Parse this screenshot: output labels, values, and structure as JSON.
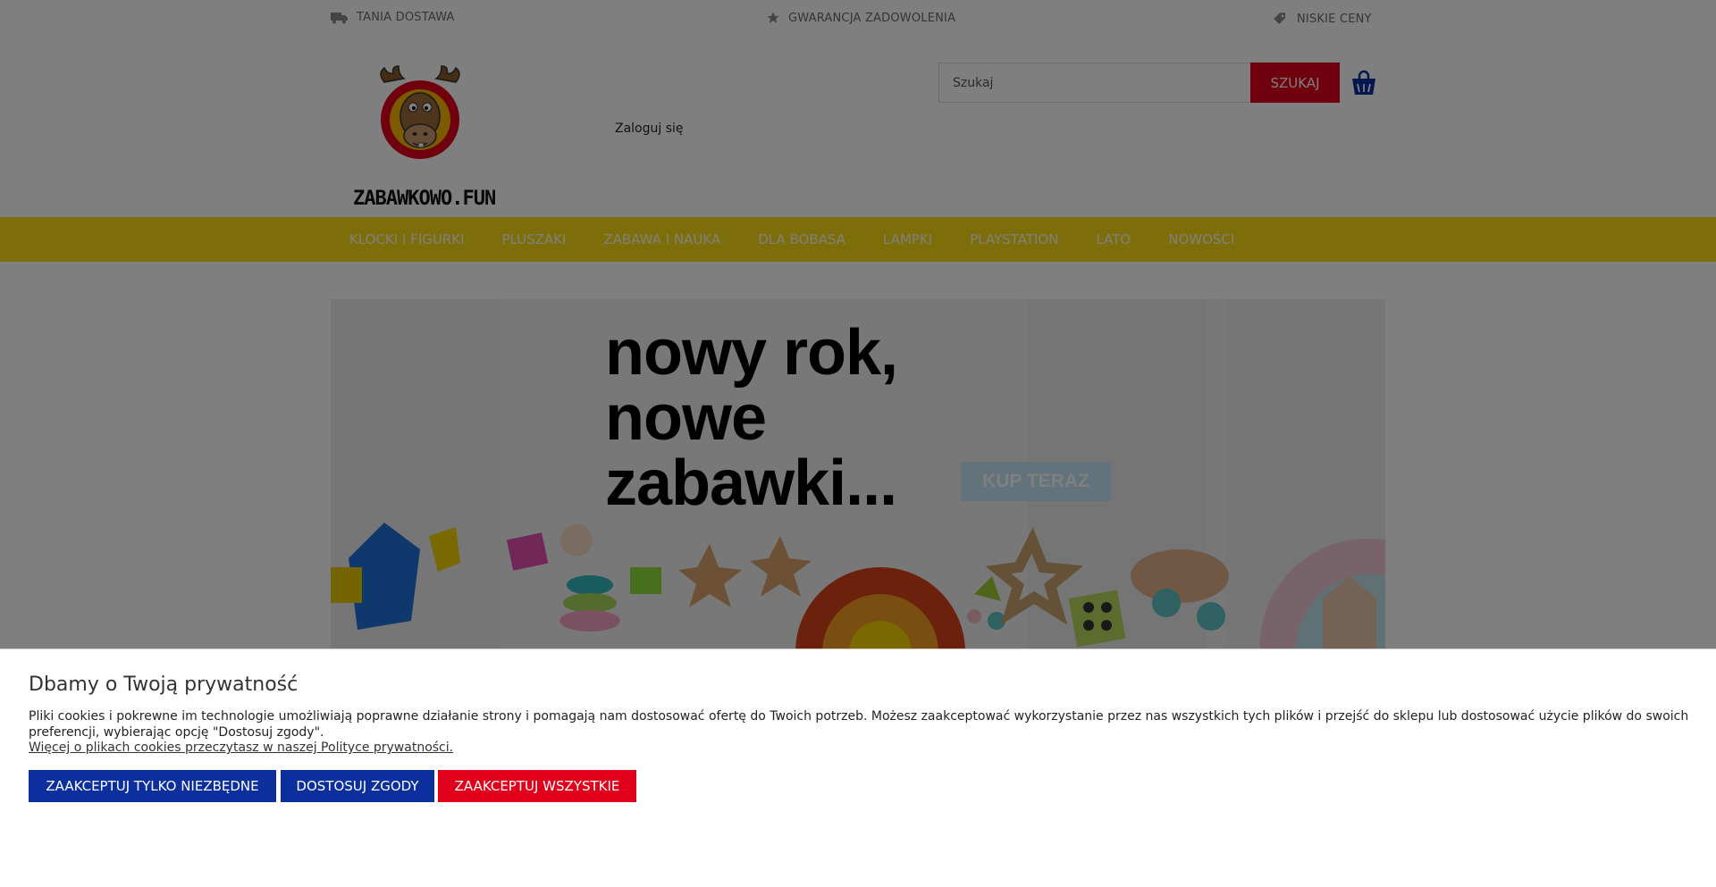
{
  "topbar": {
    "usp": [
      {
        "label": "TANIA DOSTAWA",
        "icon": "truck-icon"
      },
      {
        "label": "GWARANCJA ZADOWOLENIA",
        "icon": "star-icon"
      },
      {
        "label": "NISKIE CENY",
        "icon": "tag-icon"
      }
    ]
  },
  "header": {
    "logo_text": "ZABAWKOWO.FUN",
    "login_label": "Zaloguj się",
    "search": {
      "placeholder": "Szukaj",
      "button_label": "SZUKAJ"
    },
    "cart_icon": "shopping-bag-icon"
  },
  "nav": {
    "items": [
      "KLOCKI I FIGURKI",
      "PLUSZAKI",
      "ZABAWA I NAUKA",
      "DLA BOBASA",
      "LAMPKI",
      "PLAYSTATION",
      "LATO",
      "NOWOŚCI"
    ]
  },
  "banner": {
    "headline": [
      "nowy rok,",
      "nowe",
      "zabawki..."
    ],
    "cta_label": "KUP TERAZ"
  },
  "cookie": {
    "title": "Dbamy o Twoją prywatność",
    "text": "Pliki cookies i pokrewne im technologie umożliwiają poprawne działanie strony i pomagają nam dostosować ofertę do Twoich potrzeb. Możesz zaakceptować wykorzystanie przez nas wszystkich tych plików i przejść do sklepu lub dostosować użycie plików do swoich preferencji, wybierając opcję \"Dostosuj zgody\".",
    "link_label": "Więcej o plikach cookies przeczytasz w naszej Polityce prywatności.",
    "buttons": {
      "necessary": "ZAAKCEPTUJ TYLKO NIEZBĘDNE",
      "customize": "DOSTOSUJ ZGODY",
      "accept_all": "ZAAKCEPTUJ WSZYSTKIE"
    }
  },
  "colors": {
    "nav_bg": "#fddd15",
    "accent_red": "#e0001b",
    "button_blue": "#0b2f9d",
    "cta_light_blue": "#c5e7f7"
  }
}
